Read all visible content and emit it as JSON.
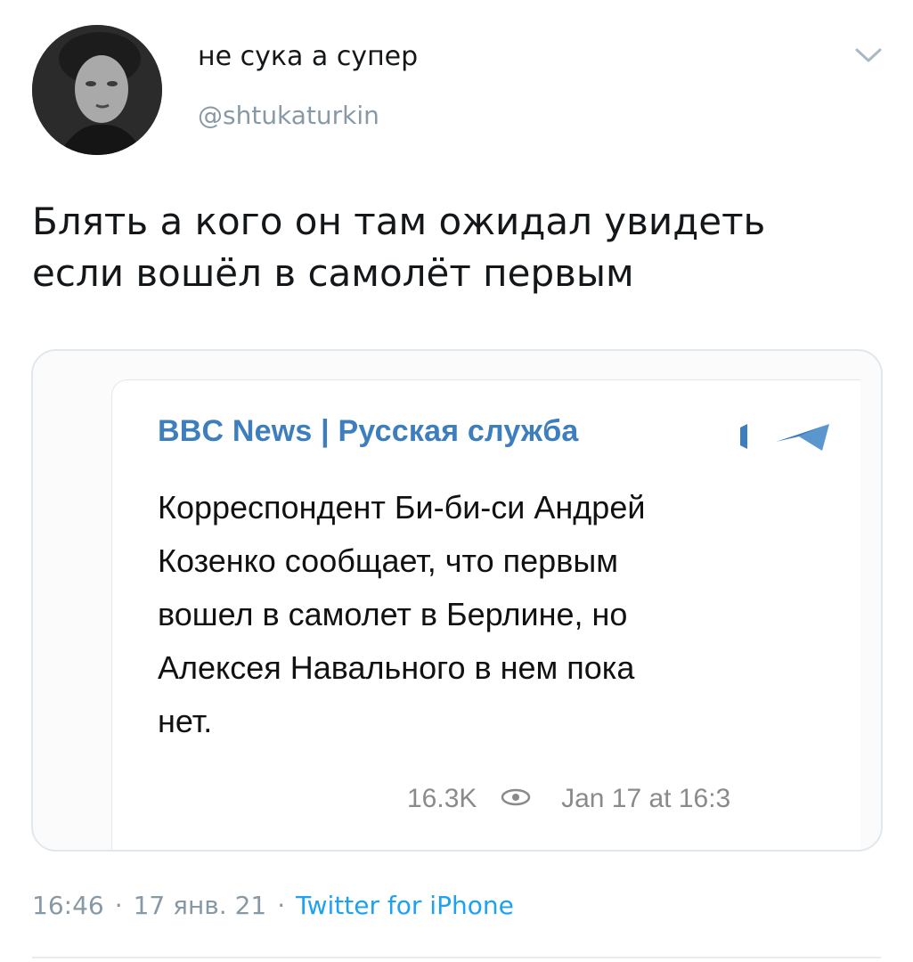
{
  "tweet": {
    "author": {
      "display_name": "не сука а супер",
      "handle": "@shtukaturkin"
    },
    "text_line1": "Блять а кого он там ожидал увидеть",
    "text_line2": "если вошёл в самолёт первым",
    "footer": {
      "time": "16:46",
      "separator": "·",
      "date": "17 янв. 21",
      "source": "Twitter for iPhone"
    }
  },
  "embedded_post": {
    "channel_name": "BBC News | Русская служба",
    "message_lines": [
      "Корреспондент Би-би-си Андрей",
      "Козенко сообщает, что первым",
      "вошел в самолет в Берлине, но",
      "Алексея Навального в нем пока",
      "нет."
    ],
    "views": "16.3K",
    "timestamp": "Jan 17 at 16:3"
  },
  "colors": {
    "channel_blue": "#3d7ebf",
    "link_blue": "#1da1f2",
    "muted_gray": "#8899a6"
  },
  "icons": {
    "menu": "chevron-down-icon",
    "channel_badge": "bookmark-icon",
    "channel_share": "send-icon",
    "views": "eye-icon"
  }
}
